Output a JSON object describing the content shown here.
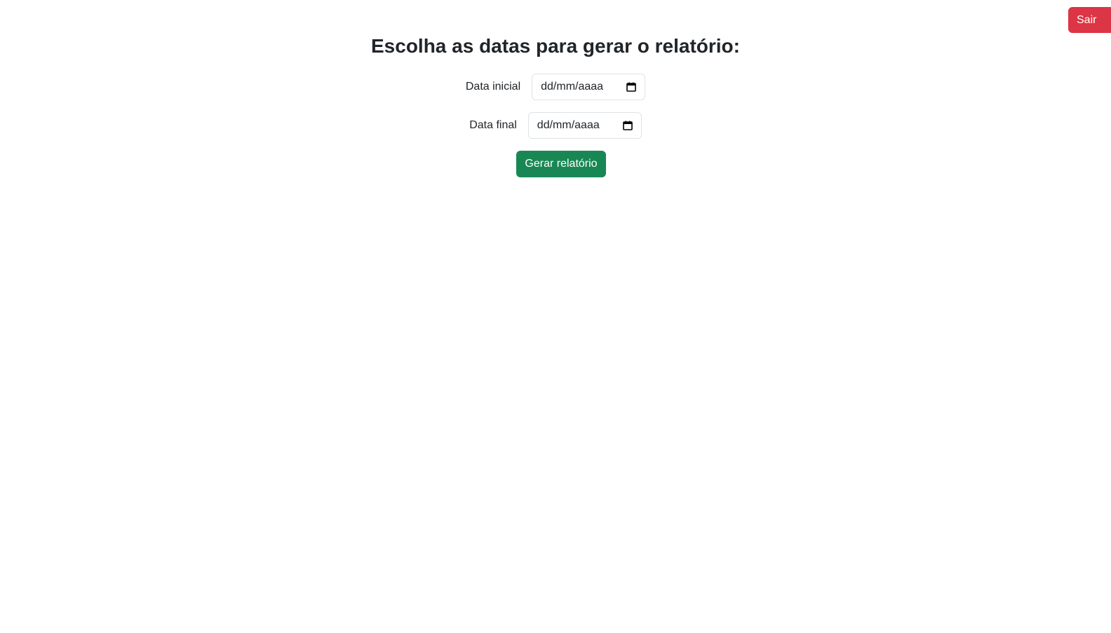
{
  "header": {
    "logout_label": "Sair"
  },
  "main": {
    "title": "Escolha as datas para gerar o relatório:",
    "start_date": {
      "label": "Data inicial",
      "placeholder": "dd/mm/aaaa",
      "value": ""
    },
    "end_date": {
      "label": "Data final",
      "placeholder": "dd/mm/aaaa",
      "value": ""
    },
    "submit_label": "Gerar relatório"
  },
  "icons": {
    "date_picker": "calendar-icon"
  },
  "colors": {
    "logout": "#dc3545",
    "submit": "#198754",
    "text": "#212529",
    "input_border": "#dee2e6"
  }
}
